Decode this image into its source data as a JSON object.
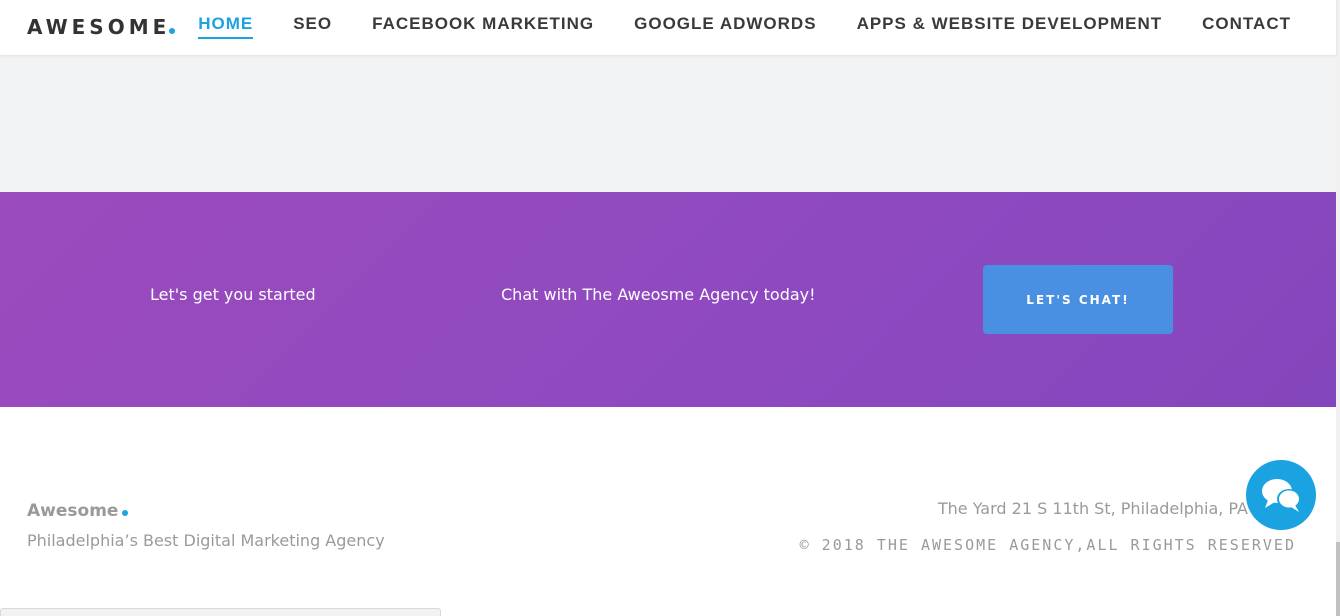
{
  "header": {
    "logo_text": "AWESOME",
    "nav": [
      {
        "label": "HOME",
        "active": true
      },
      {
        "label": "SEO",
        "active": false
      },
      {
        "label": "FACEBOOK MARKETING",
        "active": false
      },
      {
        "label": "GOOGLE ADWORDS",
        "active": false
      },
      {
        "label": "APPS & WEBSITE DEVELOPMENT",
        "active": false
      },
      {
        "label": "CONTACT",
        "active": false
      }
    ]
  },
  "cta": {
    "left_text": "Let's get you started",
    "middle_text": "Chat with The Aweosme Agency today!",
    "button_label": "LET'S CHAT!"
  },
  "footer": {
    "brand": "Awesome",
    "tagline": "Philadelphia’s Best Digital Marketing Agency",
    "address": "The Yard 21 S 11th St, Philadelphia, PA",
    "copyright": "© 2018 THE AWESOME AGENCY,ALL RIGHTS RESERVED"
  },
  "icons": {
    "chat_fab": "chat-bubbles-icon"
  },
  "colors": {
    "accent": "#1aa3e0",
    "cta_gradient_start": "#9b4bbd",
    "cta_gradient_end": "#8446bc",
    "cta_button": "#4a90e2",
    "gray_band": "#f2f3f5"
  }
}
